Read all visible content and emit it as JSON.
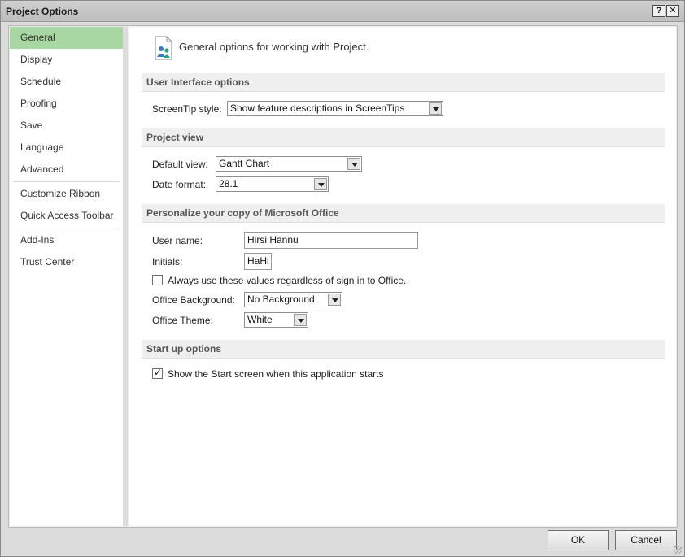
{
  "window": {
    "title": "Project Options",
    "help_label": "?",
    "close_label": "✕"
  },
  "sidebar": {
    "items": [
      {
        "label": "General",
        "active": true
      },
      {
        "label": "Display"
      },
      {
        "label": "Schedule"
      },
      {
        "label": "Proofing"
      },
      {
        "label": "Save"
      },
      {
        "label": "Language"
      },
      {
        "label": "Advanced"
      },
      {
        "label": "Customize Ribbon"
      },
      {
        "label": "Quick Access Toolbar"
      },
      {
        "label": "Add-Ins"
      },
      {
        "label": "Trust Center"
      }
    ]
  },
  "main": {
    "header": "General options for working with Project.",
    "sections": {
      "ui": {
        "title": "User Interface options",
        "screentip_label": "ScreenTip style:",
        "screentip_value": "Show feature descriptions in ScreenTips"
      },
      "project_view": {
        "title": "Project view",
        "default_view_label": "Default view:",
        "default_view_value": "Gantt Chart",
        "date_format_label": "Date format:",
        "date_format_value": "28.1"
      },
      "personalize": {
        "title": "Personalize your copy of Microsoft Office",
        "user_name_label": "User name:",
        "user_name_value": "Hirsi Hannu",
        "initials_label": "Initials:",
        "initials_value": "HaHi",
        "always_use_label": "Always use these values regardless of sign in to Office.",
        "always_use_checked": false,
        "background_label": "Office Background:",
        "background_value": "No Background",
        "theme_label": "Office Theme:",
        "theme_value": "White"
      },
      "startup": {
        "title": "Start up options",
        "show_start_label": "Show the Start screen when this application starts",
        "show_start_checked": true
      }
    }
  },
  "footer": {
    "ok_label": "OK",
    "cancel_label": "Cancel"
  },
  "colors": {
    "active_nav": "#a8d7a3",
    "section_bg": "#efefef"
  }
}
